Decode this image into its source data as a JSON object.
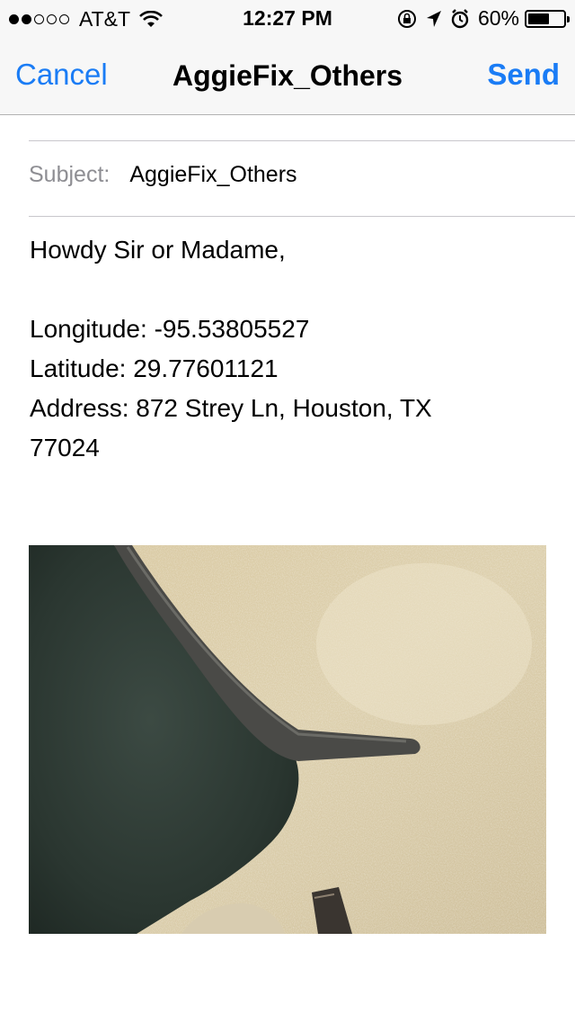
{
  "status_bar": {
    "signal_dots": [
      true,
      true,
      false,
      false,
      false
    ],
    "carrier": "AT&T",
    "time": "12:27 PM",
    "battery_percent": "60%",
    "battery_level": 0.6,
    "icons": [
      "wifi-icon",
      "orientation-lock-icon",
      "location-arrow-icon",
      "alarm-icon",
      "battery-icon"
    ]
  },
  "nav": {
    "cancel_label": "Cancel",
    "title": "AggieFix_Others",
    "send_label": "Send"
  },
  "subject": {
    "label": "Subject:",
    "value": "AggieFix_Others"
  },
  "body": {
    "greeting": "Howdy Sir or Madame,",
    "longitude": "Longitude: -95.53805527",
    "latitude": "Latitude: 29.77601121",
    "address_line1": "Address: 872 Strey Ln, Houston, TX",
    "address_line2": "77024"
  },
  "attachment": {
    "description_icon": "photo-attachment",
    "colors": {
      "carpet": "#d6c7a4",
      "chair_fabric": "#2d3a34",
      "chair_leg": "#4a4a47"
    }
  },
  "colors": {
    "accent": "#1a7cf5",
    "bar_background": "#f7f7f7",
    "separator": "#c8c7cc",
    "label_gray": "#8e8e93"
  }
}
